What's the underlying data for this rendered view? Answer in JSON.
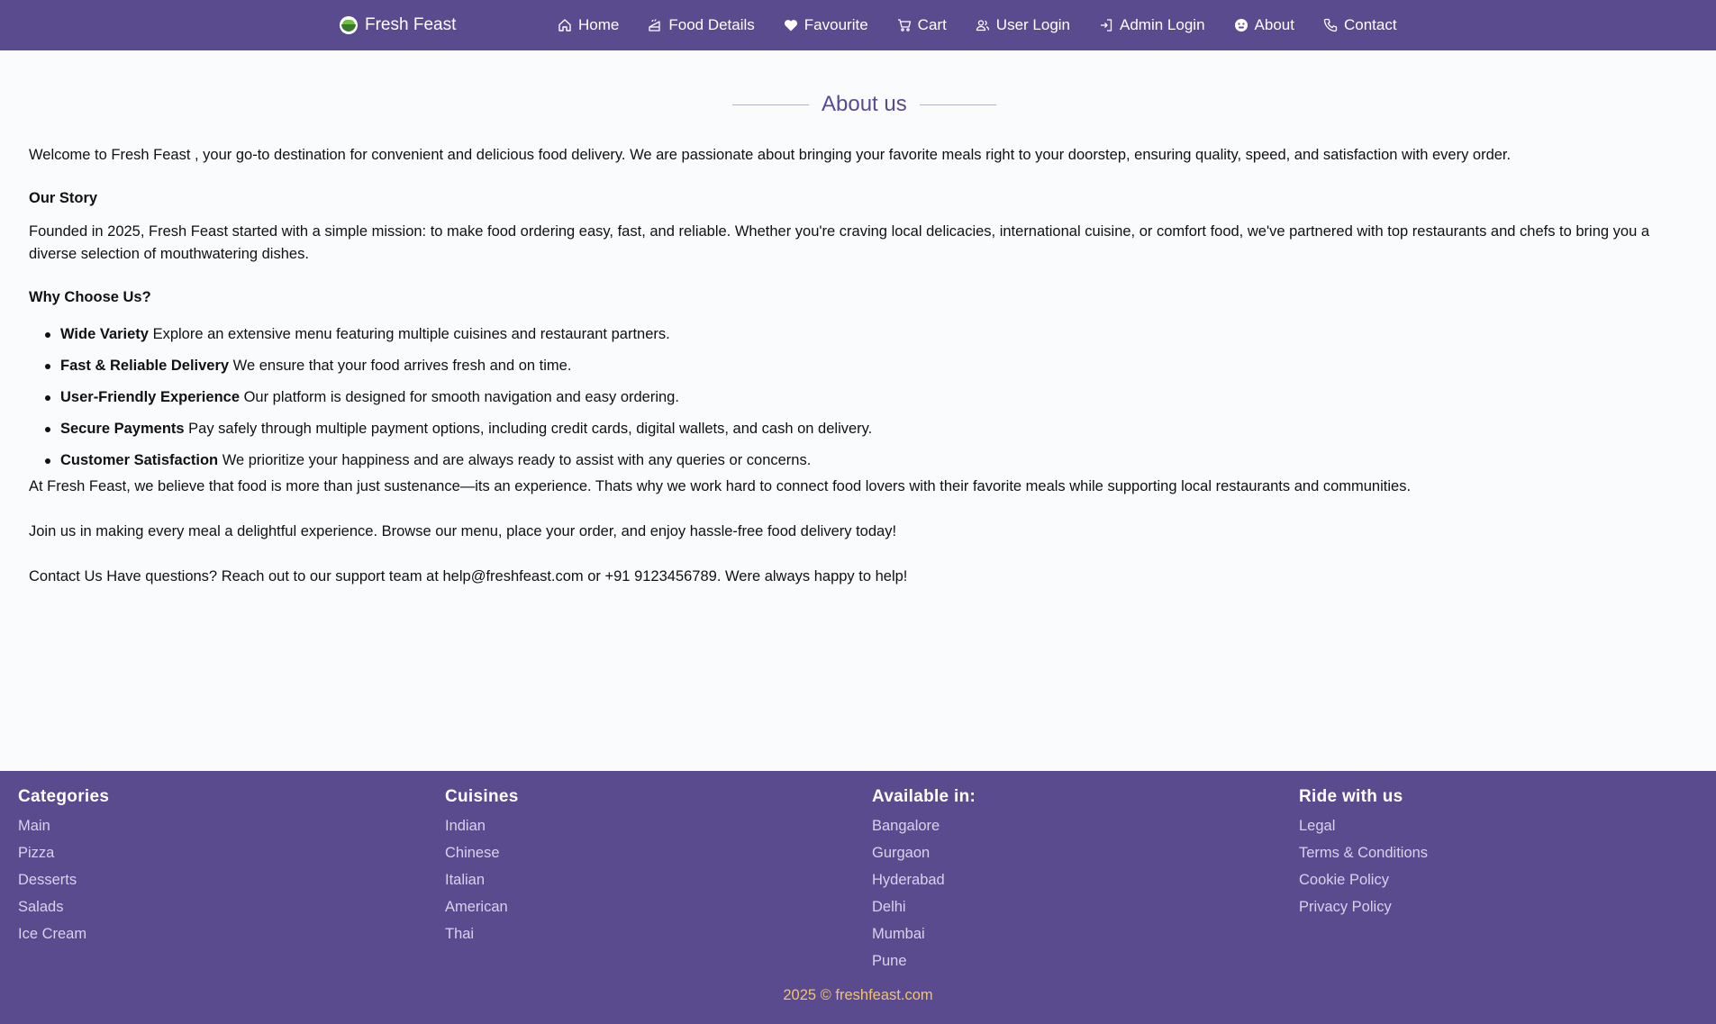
{
  "nav": {
    "brand": "Fresh Feast",
    "links": [
      {
        "label": "Home",
        "icon": "home-icon"
      },
      {
        "label": "Food Details",
        "icon": "food-icon"
      },
      {
        "label": "Favourite",
        "icon": "heart-icon"
      },
      {
        "label": "Cart",
        "icon": "cart-icon"
      },
      {
        "label": "User Login",
        "icon": "users-icon"
      },
      {
        "label": "Admin Login",
        "icon": "login-icon"
      },
      {
        "label": "About",
        "icon": "about-icon"
      },
      {
        "label": "Contact",
        "icon": "phone-icon"
      }
    ]
  },
  "about": {
    "title": "About us",
    "intro": "Welcome to Fresh Feast , your go-to destination for convenient and delicious food delivery. We are passionate about bringing your favorite meals right to your doorstep, ensuring quality, speed, and satisfaction with every order.",
    "story_heading": "Our Story",
    "story_text": "Founded in 2025, Fresh Feast started with a simple mission: to make food ordering easy, fast, and reliable. Whether you're craving local delicacies, international cuisine, or comfort food, we've partnered with top restaurants and chefs to bring you a diverse selection of mouthwatering dishes.",
    "why_heading": "Why Choose Us?",
    "reasons": [
      {
        "title": "Wide Variety",
        "text": " Explore an extensive menu featuring multiple cuisines and restaurant partners."
      },
      {
        "title": "Fast & Reliable Delivery",
        "text": " We ensure that your food arrives fresh and on time."
      },
      {
        "title": "User-Friendly Experience",
        "text": " Our platform is designed for smooth navigation and easy ordering."
      },
      {
        "title": "Secure Payments",
        "text": " Pay safely through multiple payment options, including credit cards, digital wallets, and cash on delivery."
      },
      {
        "title": "Customer Satisfaction",
        "text": " We prioritize your happiness and are always ready to assist with any queries or concerns."
      }
    ],
    "belief": "At Fresh Feast, we believe that food is more than just sustenance—its an experience. Thats why we work hard to connect food lovers with their favorite meals while supporting local restaurants and communities.",
    "join": "Join us in making every meal a delightful experience. Browse our menu, place your order, and enjoy hassle-free food delivery today!",
    "contact": "Contact Us Have questions? Reach out to our support team at help@freshfeast.com or +91 9123456789. Were always happy to help!"
  },
  "footer": {
    "columns": [
      {
        "heading": "Categories",
        "links": [
          "Main",
          "Pizza",
          "Desserts",
          "Salads",
          "Ice Cream"
        ]
      },
      {
        "heading": "Cuisines",
        "links": [
          "Indian",
          "Chinese",
          "Italian",
          "American",
          "Thai"
        ]
      },
      {
        "heading": "Available in:",
        "links": [
          "Bangalore",
          "Gurgaon",
          "Hyderabad",
          "Delhi",
          "Mumbai",
          "Pune"
        ]
      },
      {
        "heading": "Ride with us",
        "links": [
          "Legal",
          "Terms & Conditions",
          "Cookie Policy",
          "Privacy Policy"
        ]
      }
    ],
    "copyright": "2025 © freshfeast.com"
  },
  "colors": {
    "primary": "#5a4a8e",
    "footer_link": "#d8d3ea",
    "copyright": "#f1c36b",
    "background": "#fafbfd"
  }
}
